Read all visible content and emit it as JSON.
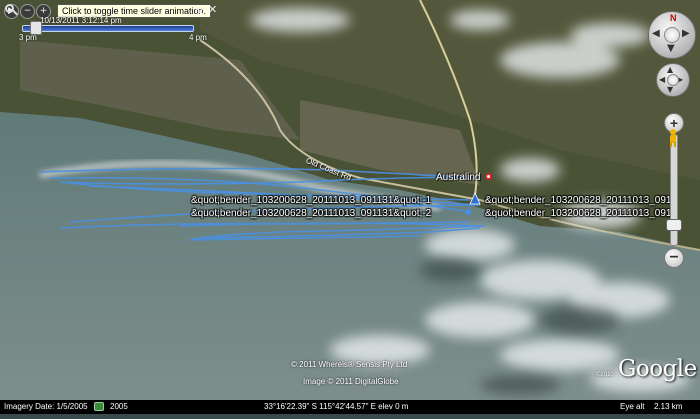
{
  "time_slider": {
    "tooltip": "Click to toggle time slider animation.",
    "datetime": "10/13/2011  3:12:14 pm",
    "start_label": "3 pm",
    "end_label": "4 pm"
  },
  "map": {
    "place_label": "Australind",
    "road_label": "Old Coast Rd",
    "gps_labels": [
      "&quot;bender_103200628_20111013_091131&quot;-1",
      "&quot;bender_103200628_20111013_091131&quot;-2",
      "&quot;bender_103200628_20111013_0911",
      "&quot;bender_103200628_20111013_091"
    ],
    "track_color": "#4a90e2",
    "copyright_1": "© 2011 Whereis® Sensis Pty Ltd",
    "copyright_2": "Image © 2011 DigitalGlobe",
    "google_logo": "Google",
    "google_year": "©2010"
  },
  "status_bar": {
    "imagery_date": "Imagery Date: 1/5/2005",
    "year_badge": "2005",
    "coordinates": "33°16'22.39\" S  115°42'44.57\" E elev    0 m",
    "eye_alt": "Eye alt",
    "eye_alt_value": "2.13 km"
  },
  "icons": {
    "search": "search-icon",
    "play": "play-icon",
    "wrench": "wrench-icon",
    "close": "close-icon"
  }
}
